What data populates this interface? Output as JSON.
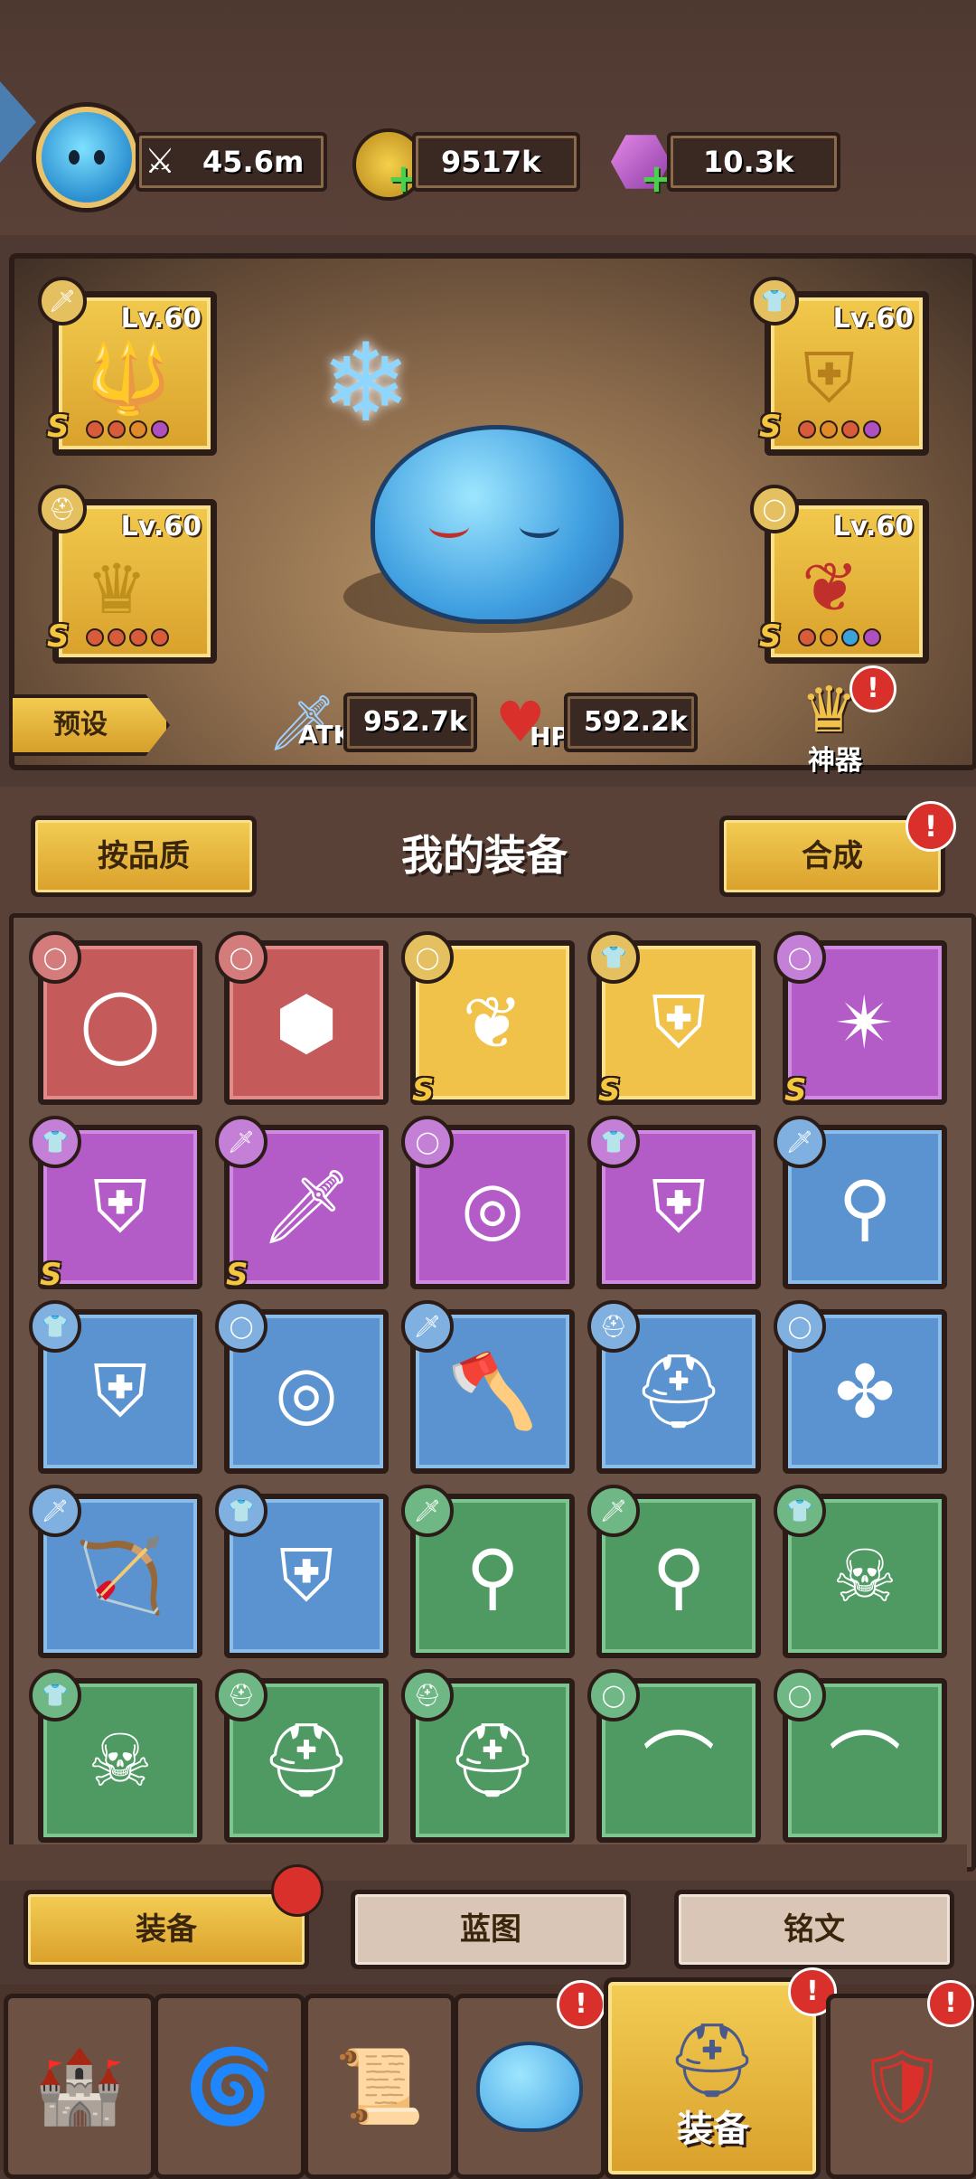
{
  "header": {
    "power": "45.6m",
    "gold": "9517k",
    "gems": "10.3k"
  },
  "hero": {
    "equipped": [
      {
        "level": "Lv.60",
        "grade": "S",
        "type": "sword-icon",
        "art": "trident-icon"
      },
      {
        "level": "Lv.60",
        "grade": "S",
        "type": "armor-icon",
        "art": "gold-armor-icon"
      },
      {
        "level": "Lv.60",
        "grade": "S",
        "type": "helmet-icon",
        "art": "crown-icon"
      },
      {
        "level": "Lv.60",
        "grade": "S",
        "type": "ring-icon",
        "art": "amulet-icon"
      }
    ],
    "atk_label": "ATK",
    "atk_value": "952.7k",
    "hp_label": "HP",
    "hp_value": "592.2k",
    "preset_label": "预设",
    "artifact_label": "神器"
  },
  "equipment": {
    "sort_label": "按品质",
    "title": "我的装备",
    "merge_label": "合成",
    "items": [
      {
        "color": "red",
        "type": "ring",
        "grade": "",
        "icon": "◯"
      },
      {
        "color": "red",
        "type": "ring",
        "grade": "",
        "icon": "⬢"
      },
      {
        "color": "gold",
        "type": "ring",
        "grade": "S",
        "icon": "❦"
      },
      {
        "color": "gold",
        "type": "armor",
        "grade": "S",
        "icon": "⛨"
      },
      {
        "color": "purple",
        "type": "ring",
        "grade": "S",
        "icon": "✴"
      },
      {
        "color": "purple",
        "type": "armor",
        "grade": "S",
        "icon": "⛨"
      },
      {
        "color": "purple",
        "type": "sword",
        "grade": "S",
        "icon": "🗡"
      },
      {
        "color": "purple",
        "type": "ring",
        "grade": "",
        "icon": "◎"
      },
      {
        "color": "purple",
        "type": "armor",
        "grade": "",
        "icon": "⛨"
      },
      {
        "color": "blue",
        "type": "sword",
        "grade": "",
        "icon": "⚲"
      },
      {
        "color": "blue",
        "type": "armor",
        "grade": "",
        "icon": "⛨"
      },
      {
        "color": "blue",
        "type": "ring",
        "grade": "",
        "icon": "◎"
      },
      {
        "color": "blue",
        "type": "sword",
        "grade": "",
        "icon": "🪓"
      },
      {
        "color": "blue",
        "type": "helmet",
        "grade": "",
        "icon": "⛑"
      },
      {
        "color": "blue",
        "type": "ring",
        "grade": "",
        "icon": "✤"
      },
      {
        "color": "blue",
        "type": "sword",
        "grade": "",
        "icon": "🏹"
      },
      {
        "color": "blue",
        "type": "armor",
        "grade": "",
        "icon": "⛨"
      },
      {
        "color": "green",
        "type": "sword",
        "grade": "",
        "icon": "⚲"
      },
      {
        "color": "green",
        "type": "sword",
        "grade": "",
        "icon": "⚲"
      },
      {
        "color": "green",
        "type": "armor",
        "grade": "",
        "icon": "☠"
      },
      {
        "color": "green",
        "type": "armor",
        "grade": "",
        "icon": "☠"
      },
      {
        "color": "green",
        "type": "helmet",
        "grade": "",
        "icon": "⛑"
      },
      {
        "color": "green",
        "type": "helmet",
        "grade": "",
        "icon": "⛑"
      },
      {
        "color": "green",
        "type": "ring",
        "grade": "",
        "icon": "⌒"
      },
      {
        "color": "green",
        "type": "ring",
        "grade": "",
        "icon": "⌒"
      }
    ]
  },
  "tabs": [
    {
      "label": "装备",
      "active": true
    },
    {
      "label": "蓝图",
      "active": false
    },
    {
      "label": "铭文",
      "active": false
    }
  ],
  "nav": {
    "active_label": "装备",
    "items": [
      "castle-icon",
      "rune-stone-icon",
      "scroll-map-icon",
      "slime-icon",
      "helmet-icon",
      "guild-banner-icon"
    ]
  },
  "colors": {
    "red": "#c55a5a",
    "gold": "#f0c24a",
    "purple": "#b35cc7",
    "blue": "#5a93cf",
    "green": "#4e9a62",
    "badge_red": "#d9302c"
  }
}
